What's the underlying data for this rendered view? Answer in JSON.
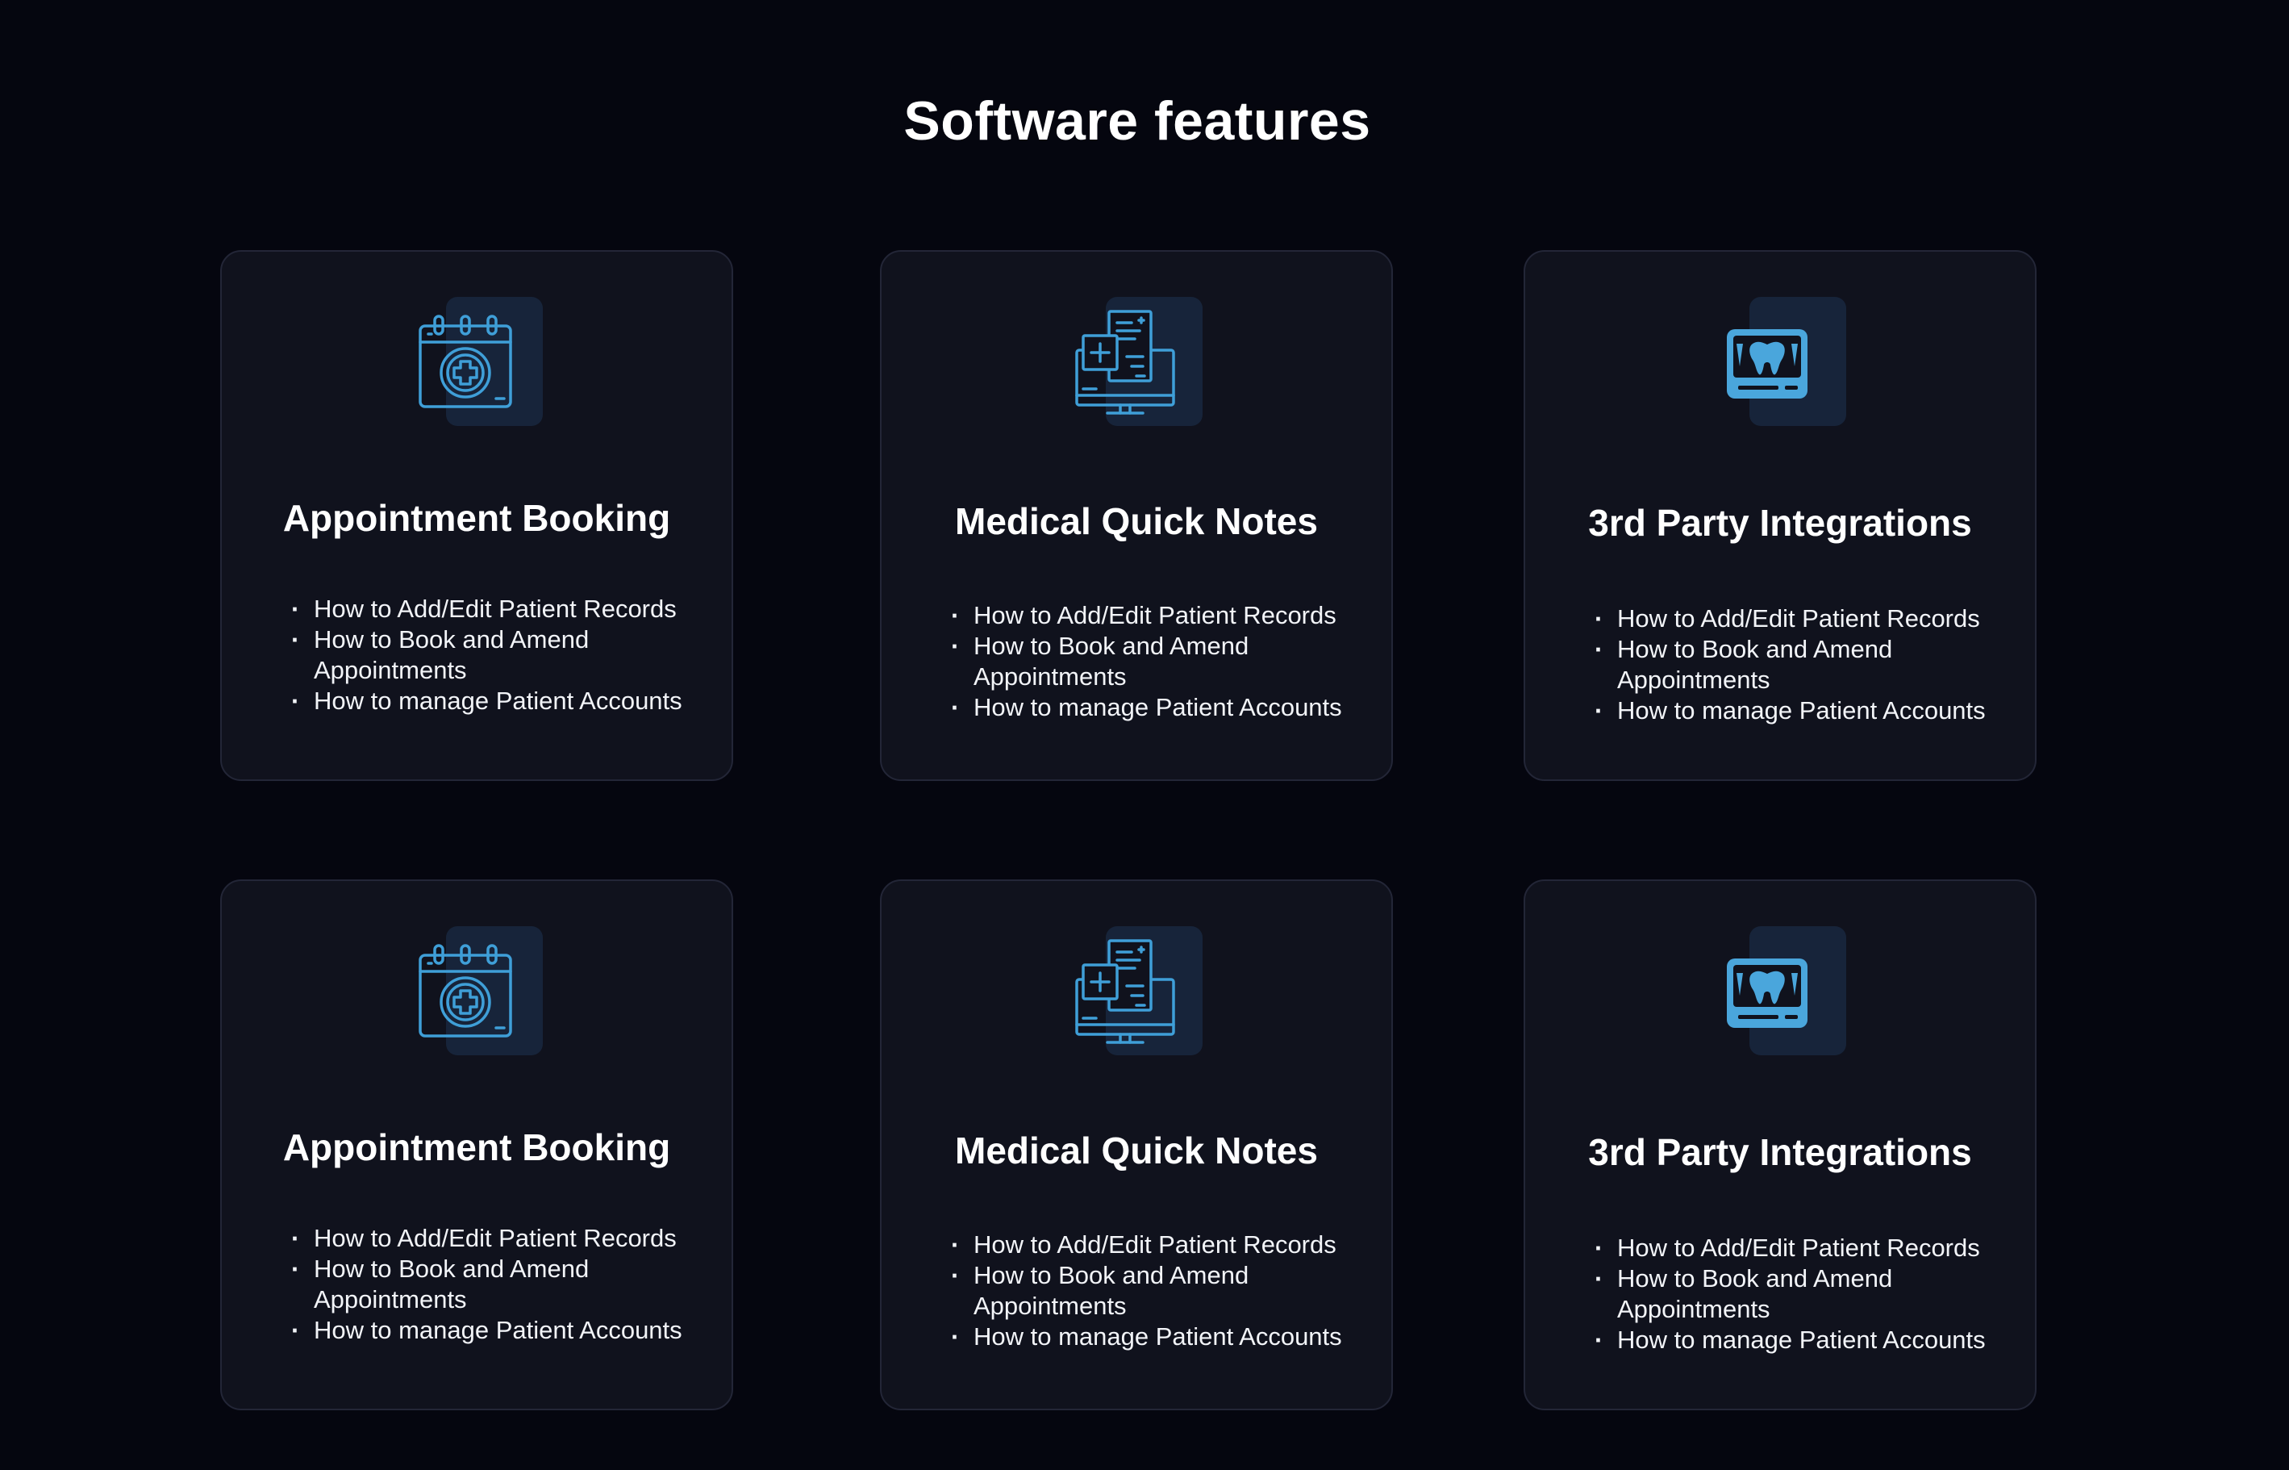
{
  "page": {
    "title": "Software features",
    "background_color": "#05060f",
    "card_color": "#10121d",
    "accent_color": "#3f9fd8"
  },
  "cards": [
    {
      "title": "Appointment Booking",
      "icon": "calendar-medical-icon",
      "items": [
        "How to Add/Edit Patient Records",
        "How to Book and Amend Appointments",
        "How to manage Patient Accounts"
      ]
    },
    {
      "title": "Medical Quick Notes",
      "icon": "medical-notes-monitor-icon",
      "items": [
        "How to Add/Edit Patient Records",
        "How to Book and Amend Appointments",
        "How to manage Patient Accounts"
      ]
    },
    {
      "title": "3rd Party Integrations",
      "icon": "dental-xray-icon",
      "items": [
        "How to Add/Edit Patient Records",
        "How to Book and Amend Appointments",
        "How to manage Patient Accounts"
      ]
    },
    {
      "title": "Appointment Booking",
      "icon": "calendar-medical-icon",
      "items": [
        "How to Add/Edit Patient Records",
        "How to Book and Amend Appointments",
        "How to manage Patient Accounts"
      ]
    },
    {
      "title": "Medical Quick Notes",
      "icon": "medical-notes-monitor-icon",
      "items": [
        "How to Add/Edit Patient Records",
        "How to Book and Amend Appointments",
        "How to manage Patient Accounts"
      ]
    },
    {
      "title": "3rd Party Integrations",
      "icon": "dental-xray-icon",
      "items": [
        "How to Add/Edit Patient Records",
        "How to Book and Amend Appointments",
        "How to manage Patient Accounts"
      ]
    }
  ]
}
